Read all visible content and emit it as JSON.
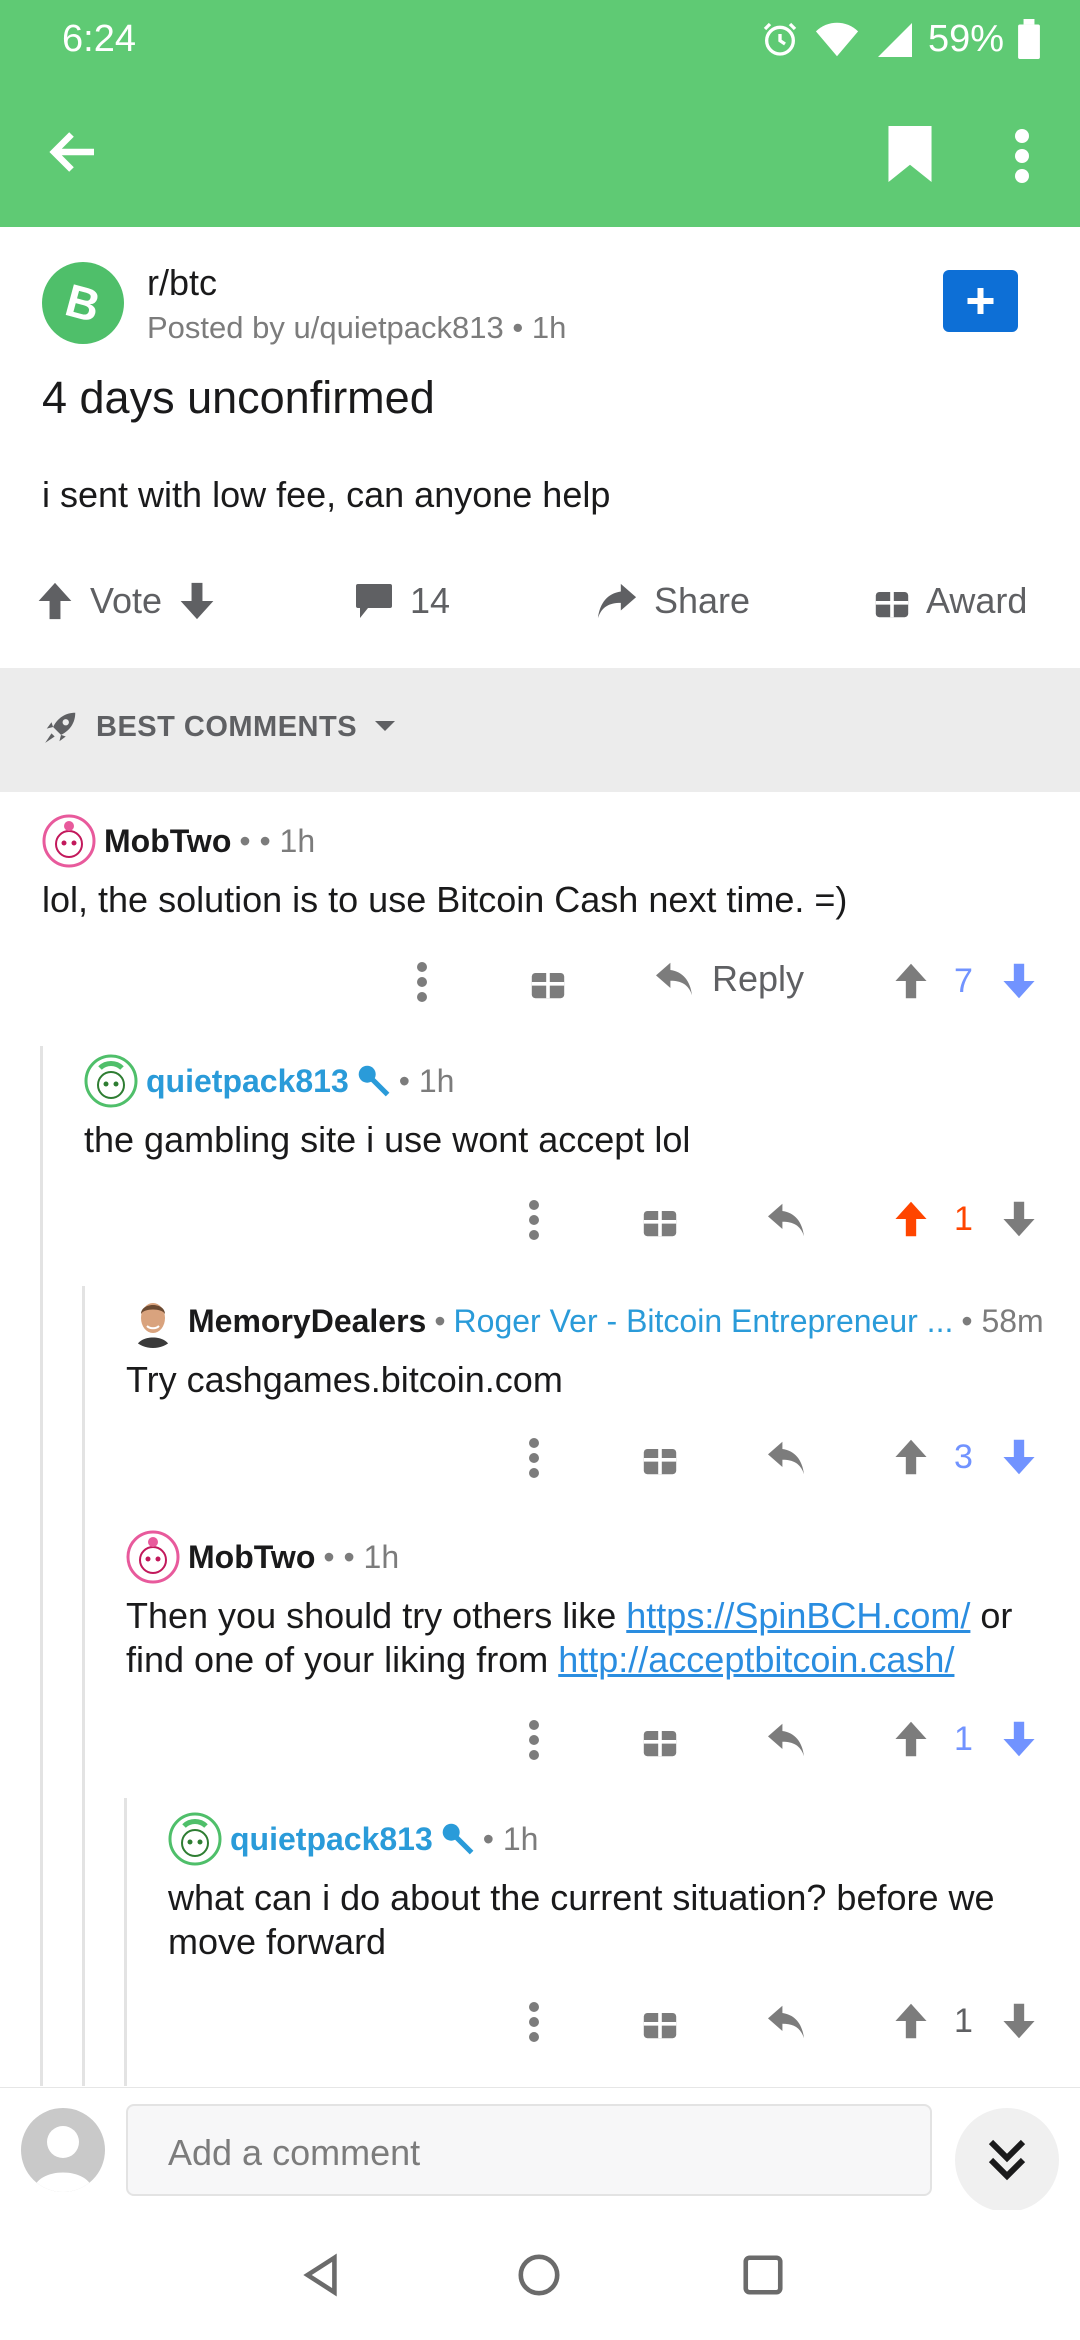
{
  "status_bar": {
    "time": "6:24",
    "battery_pct": "59%"
  },
  "post": {
    "subreddit": "r/btc",
    "posted_by": "Posted by u/quietpack813 • 1h",
    "title": "4 days unconfirmed",
    "body": "i sent with low fee, can anyone help",
    "actions": {
      "vote_label": "Vote",
      "comments_count": "14",
      "share_label": "Share",
      "award_label": "Award"
    }
  },
  "sort": {
    "label": "BEST COMMENTS"
  },
  "comments": [
    {
      "author": "MobTwo",
      "meta": "• • 1h",
      "text": "lol, the solution is to use Bitcoin Cash next time. =)",
      "reply_label": "Reply",
      "score": "7"
    },
    {
      "author": "quietpack813",
      "meta": "• 1h",
      "text": "the gambling site i use wont accept lol",
      "score": "1"
    },
    {
      "author": "MemoryDealers",
      "flair": "Roger Ver - Bitcoin Entrepreneur ...",
      "meta": "• 58m",
      "text": "Try cashgames.bitcoin.com",
      "score": "3"
    },
    {
      "author": "MobTwo",
      "meta": "• • 1h",
      "text_pre": "Then you should try others like ",
      "link1": "https://SpinBCH.com/",
      "text_mid": " or find one of your liking from ",
      "link2": "http://acceptbitcoin.cash/",
      "score": "1"
    },
    {
      "author": "quietpack813",
      "meta": "• 1h",
      "text": "what can i do about the current situation? before we move forward",
      "score": "1"
    }
  ],
  "composer": {
    "placeholder": "Add a comment"
  },
  "colors": {
    "header_green": "#5fca74",
    "op_blue": "#2a9bd9",
    "upvote_orange": "#ff4500",
    "downvote_blue": "#7193ff"
  }
}
